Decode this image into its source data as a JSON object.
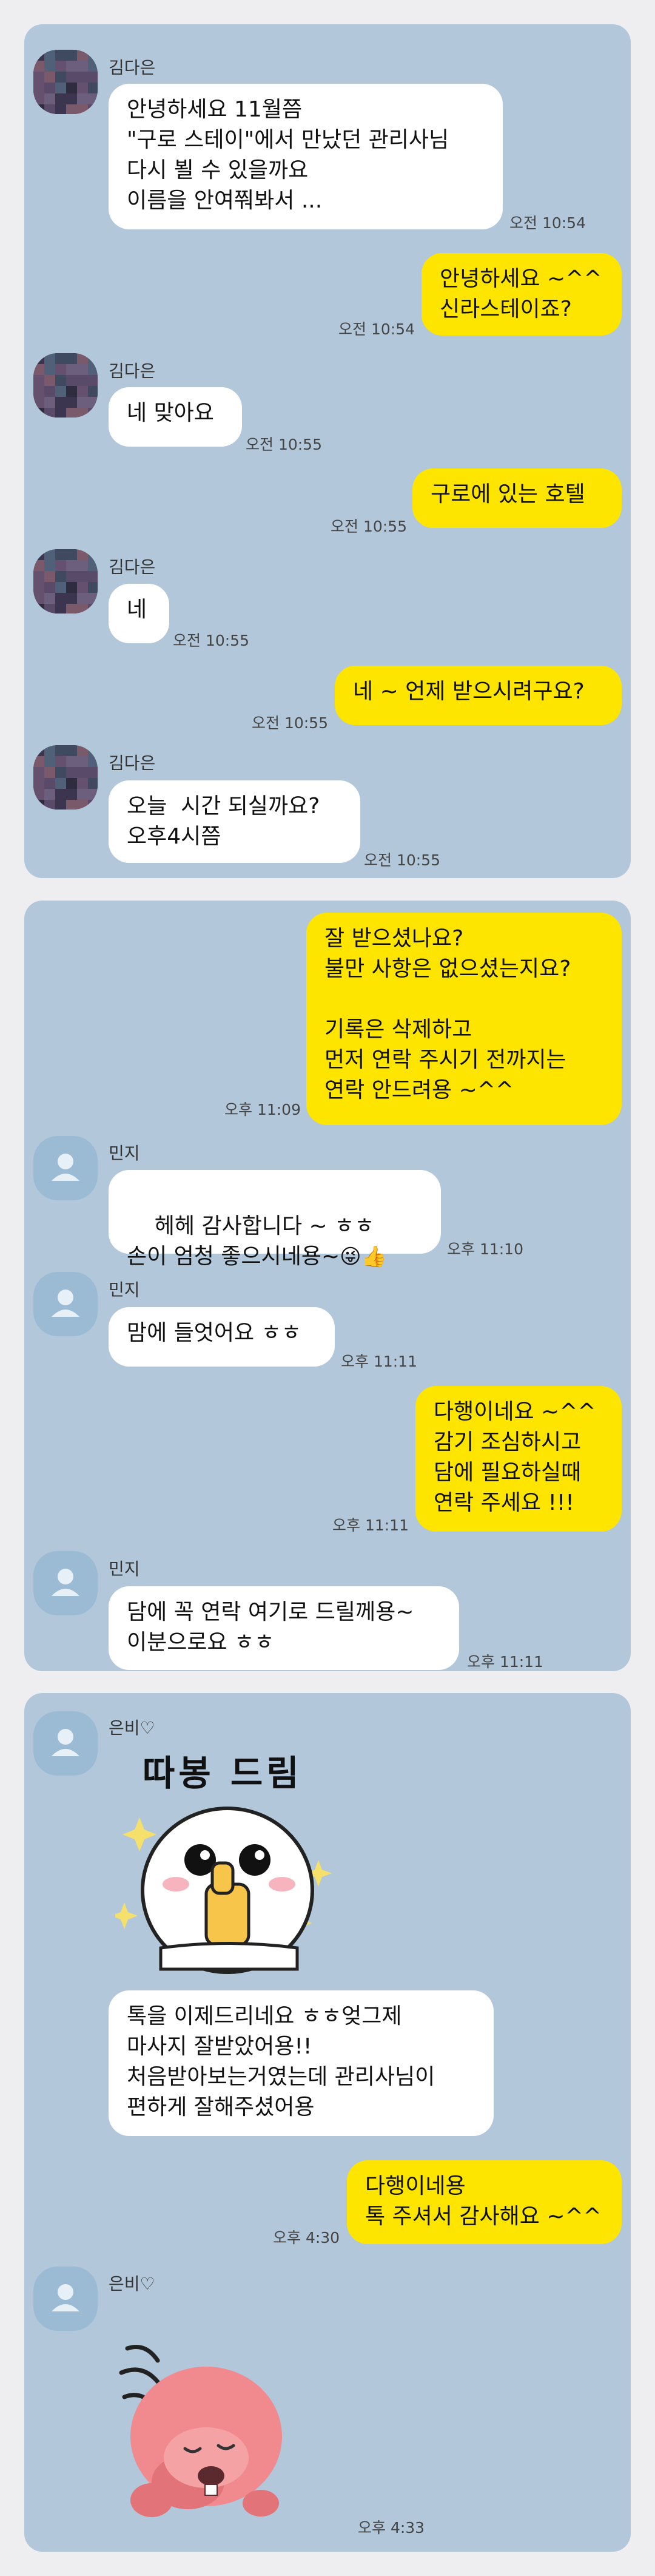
{
  "panel1": {
    "sender": "김다은",
    "msg1": "안녕하세요 11월쯤\n\"구로 스테이\"에서 만났던 관리사님\n다시 뵐 수 있을까요\n이름을 안여쭤봐서 ...",
    "time1": "오전 10:54",
    "msg2": "안녕하세요 ~^^\n신라스테이죠?",
    "time2": "오전 10:54",
    "msg3": "네 맞아요",
    "time3": "오전 10:55",
    "msg4": "구로에 있는 호텔",
    "time4": "오전 10:55",
    "msg5": "네",
    "time5": "오전 10:55",
    "msg6": "네 ~ 언제 받으시려구요?",
    "time6": "오전 10:55",
    "msg7": "오늘  시간 되실까요?\n오후4시쯤",
    "time7": "오전 10:55"
  },
  "panel2": {
    "sender": "민지",
    "msg1": "잘 받으셨나요?\n불만 사항은 없으셨는지요?\n\n기록은 삭제하고\n먼저 연락 주시기 전까지는\n연락 안드려용 ~^^",
    "time1": "오후 11:09",
    "msg2": "헤헤 감사합니다 ~ ㅎㅎ\n손이 엄청 좋으시네용~",
    "emoji2": "😜👍",
    "time2": "오후 11:10",
    "msg3": "맘에 들엇어요 ㅎㅎ",
    "time3": "오후 11:11",
    "msg4": "다행이네요 ~^^\n감기 조심하시고\n담에 필요하실때\n연락 주세요 !!!",
    "time4": "오후 11:11",
    "msg5": "담에 꼭 연락 여기로 드릴께용~\n이분으로요 ㅎㅎ",
    "time5": "오후 11:11"
  },
  "panel3": {
    "sender": "은비♡",
    "sticker1_text": "따봉 드림",
    "msg1": "톡을 이제드리네요 ㅎㅎ엊그제\n마사지 잘받았어용!!\n처음받아보는거였는데 관리사님이\n편하게 잘해주셨어용",
    "msg2": "다행이네용\n톡 주셔서 감사해요 ~^^",
    "time2": "오후 4:30",
    "sender2": "은비♡",
    "time3": "오후 4:33"
  },
  "colors": {
    "background": "#b2c7d9",
    "mine_bubble": "#fee500",
    "their_bubble": "#ffffff"
  }
}
